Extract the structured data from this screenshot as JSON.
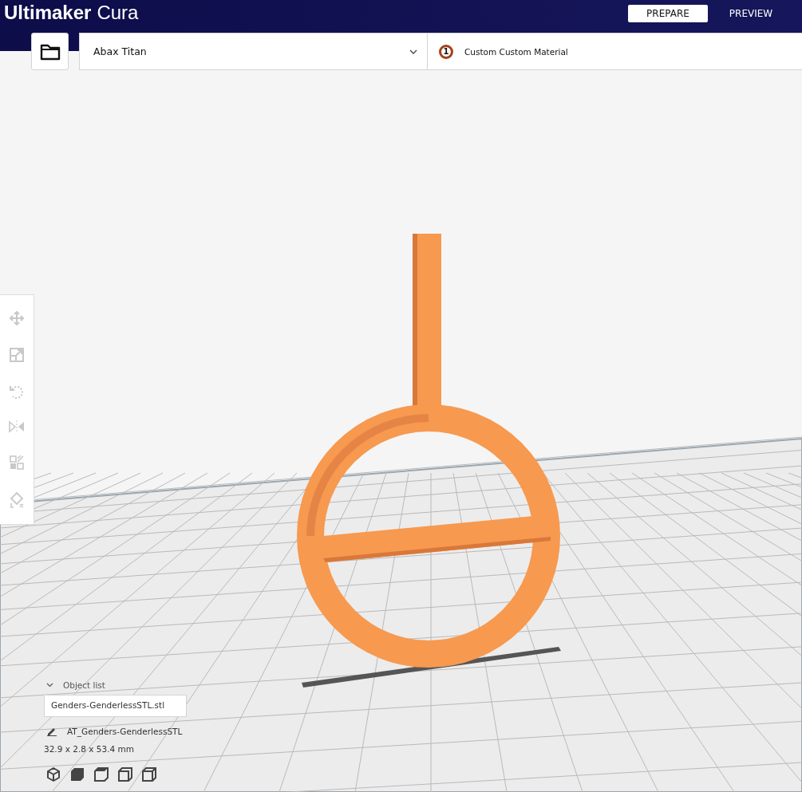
{
  "header": {
    "brand": "Ultimaker",
    "product": "Cura",
    "tabs": [
      {
        "label": "PREPARE",
        "selected": true
      },
      {
        "label": "PREVIEW",
        "selected": false
      }
    ]
  },
  "toolbar": {
    "printer": "Abax Titan",
    "extruder": "1",
    "material": "Custom Custom Material"
  },
  "object_list": {
    "title": "Object list",
    "expanded": true,
    "files": [
      "Genders-GenderlessSTL.stl"
    ],
    "object_name": "AT_Genders-GenderlessSTL",
    "dimensions": "32.9 x 2.8 x 53.4 mm"
  }
}
